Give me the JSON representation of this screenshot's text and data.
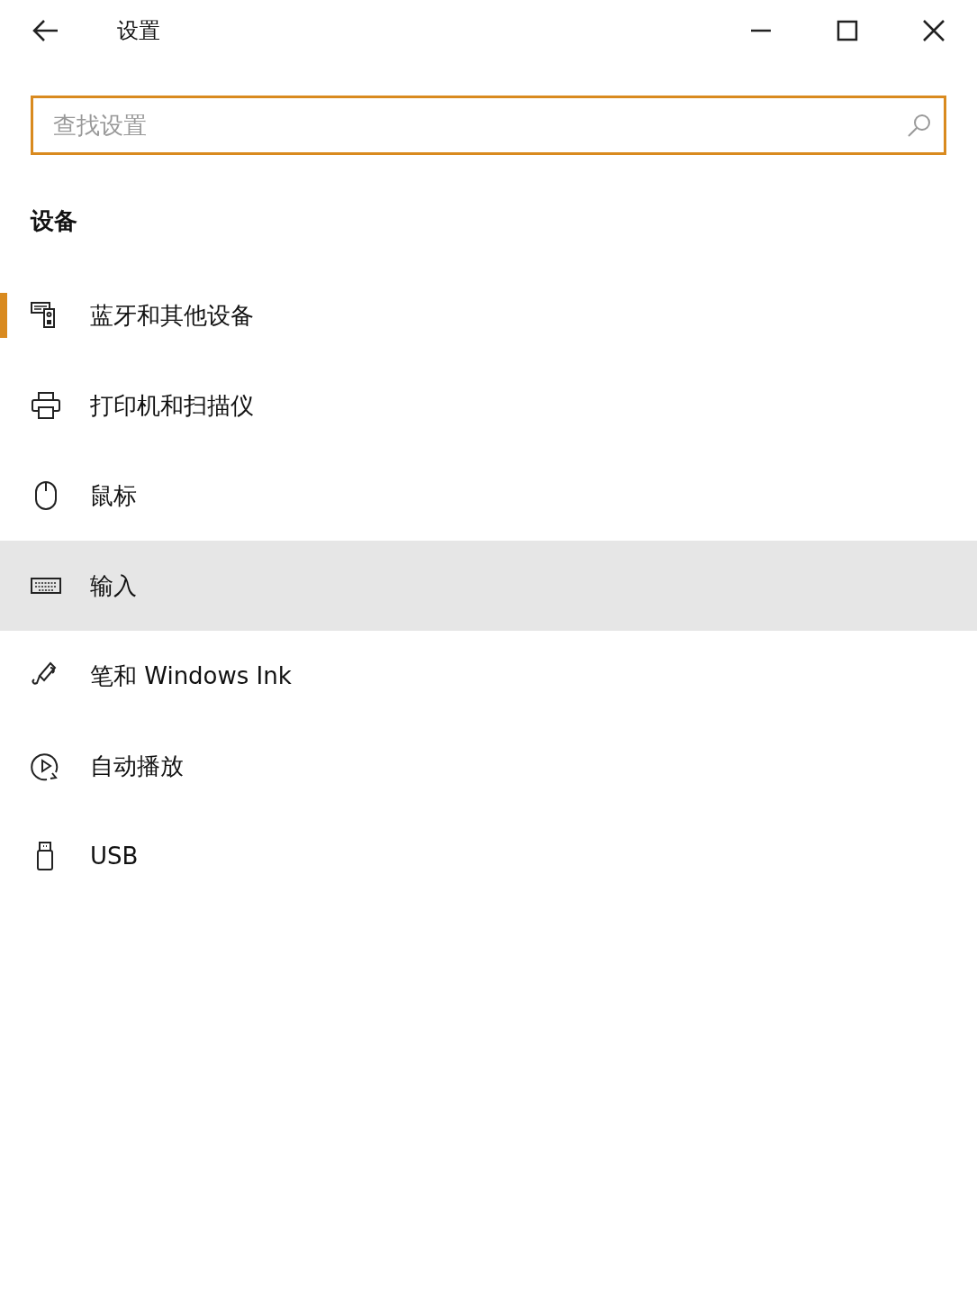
{
  "window": {
    "title": "设置"
  },
  "search": {
    "placeholder": "查找设置"
  },
  "section": {
    "title": "设备"
  },
  "items": [
    {
      "label": "蓝牙和其他设备",
      "kind": "bluetooth",
      "selected": true,
      "hovered": false
    },
    {
      "label": "打印机和扫描仪",
      "kind": "printer",
      "selected": false,
      "hovered": false
    },
    {
      "label": "鼠标",
      "kind": "mouse",
      "selected": false,
      "hovered": false
    },
    {
      "label": "输入",
      "kind": "keyboard",
      "selected": false,
      "hovered": true
    },
    {
      "label": "笔和 Windows Ink",
      "kind": "pen",
      "selected": false,
      "hovered": false
    },
    {
      "label": "自动播放",
      "kind": "autoplay",
      "selected": false,
      "hovered": false
    },
    {
      "label": "USB",
      "kind": "usb",
      "selected": false,
      "hovered": false
    }
  ]
}
